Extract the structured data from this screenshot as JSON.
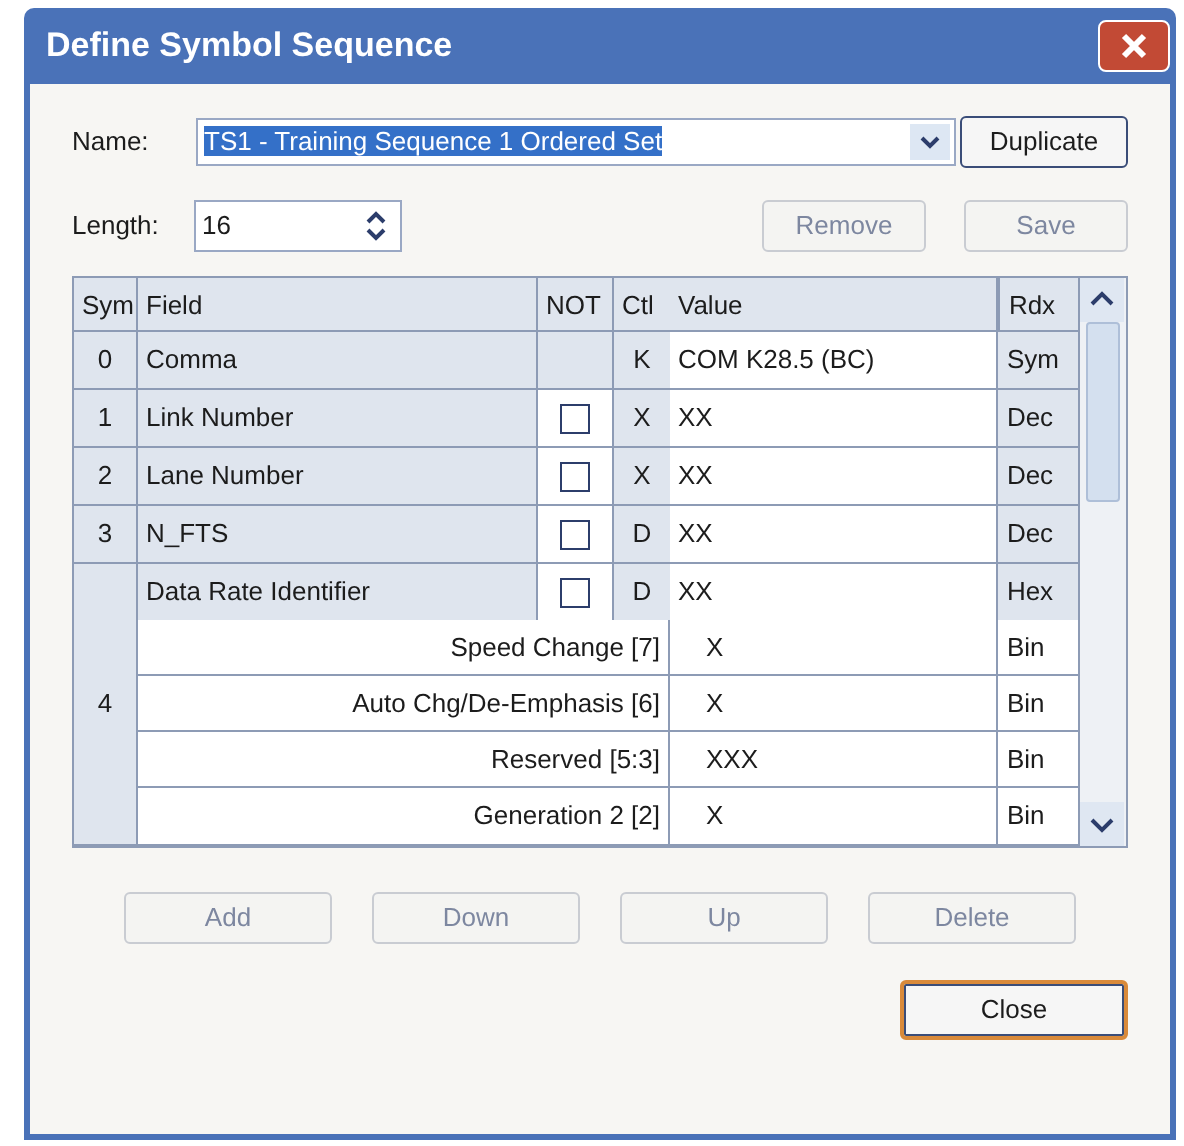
{
  "window": {
    "title": "Define Symbol Sequence"
  },
  "name_field": {
    "label": "Name:",
    "value": "TS1 - Training Sequence 1 Ordered Set",
    "selected": true
  },
  "duplicate_button": {
    "label": "Duplicate",
    "disabled": false
  },
  "length_field": {
    "label": "Length:",
    "value": "16"
  },
  "top_buttons": [
    {
      "label": "Remove",
      "disabled": true
    },
    {
      "label": "Save",
      "disabled": true
    }
  ],
  "table": {
    "columns": [
      "Sym",
      "Field",
      "NOT",
      "Ctl",
      "Value",
      "Rdx"
    ],
    "rows": [
      {
        "sym": "0",
        "items": [
          {
            "kind": "field",
            "field": "Comma",
            "ctl": "K",
            "value": "COM K28.5 (BC)",
            "rdx": "Sym"
          }
        ]
      },
      {
        "sym": "1",
        "items": [
          {
            "kind": "field",
            "field": "Link Number",
            "not": false,
            "ctl": "X",
            "value": "XX",
            "rdx": "Dec"
          }
        ]
      },
      {
        "sym": "2",
        "items": [
          {
            "kind": "field",
            "field": "Lane Number",
            "not": false,
            "ctl": "X",
            "value": "XX",
            "rdx": "Dec"
          }
        ]
      },
      {
        "sym": "3",
        "items": [
          {
            "kind": "field",
            "field": "N_FTS",
            "not": false,
            "ctl": "D",
            "value": "XX",
            "rdx": "Dec"
          }
        ]
      },
      {
        "sym": "4",
        "items": [
          {
            "kind": "field",
            "field": "Data Rate Identifier",
            "not": false,
            "ctl": "D",
            "value": "XX",
            "rdx": "Hex"
          },
          {
            "kind": "bit",
            "field": "Speed Change [7]",
            "value": "X",
            "rdx": "Bin"
          },
          {
            "kind": "bit",
            "field": "Auto Chg/De-Emphasis [6]",
            "value": "X",
            "rdx": "Bin"
          },
          {
            "kind": "bit",
            "field": "Reserved [5:3]",
            "value": "XXX",
            "rdx": "Bin"
          },
          {
            "kind": "bit",
            "field": "Generation 2 [2]",
            "value": "X",
            "rdx": "Bin"
          }
        ]
      }
    ]
  },
  "bottom_buttons": [
    {
      "label": "Add",
      "disabled": true
    },
    {
      "label": "Down",
      "disabled": true
    },
    {
      "label": "Up",
      "disabled": true
    },
    {
      "label": "Delete",
      "disabled": true
    }
  ],
  "close_button": {
    "label": "Close",
    "disabled": false
  }
}
